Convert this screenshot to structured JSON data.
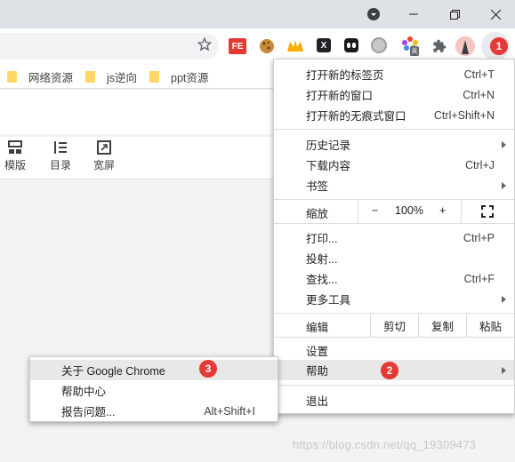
{
  "bookmarks": [
    "网络资源",
    "js逆向",
    "ppt资源"
  ],
  "page_tools": [
    {
      "label": "模版",
      "icon": "template-icon"
    },
    {
      "label": "目录",
      "icon": "list-icon"
    },
    {
      "label": "宽屏",
      "icon": "widescreen-icon"
    }
  ],
  "extensions": {
    "fe_label": "FE",
    "x_label": "X",
    "flower_badge": "关"
  },
  "menu": {
    "new_tab": {
      "label": "打开新的标签页",
      "shortcut": "Ctrl+T"
    },
    "new_window": {
      "label": "打开新的窗口",
      "shortcut": "Ctrl+N"
    },
    "new_incognito": {
      "label": "打开新的无痕式窗口",
      "shortcut": "Ctrl+Shift+N"
    },
    "history": {
      "label": "历史记录"
    },
    "downloads": {
      "label": "下载内容",
      "shortcut": "Ctrl+J"
    },
    "bookmarks": {
      "label": "书签"
    },
    "zoom": {
      "label": "缩放",
      "minus": "−",
      "value": "100%",
      "plus": "+"
    },
    "print": {
      "label": "打印...",
      "shortcut": "Ctrl+P"
    },
    "cast": {
      "label": "投射..."
    },
    "find": {
      "label": "查找...",
      "shortcut": "Ctrl+F"
    },
    "more_tools": {
      "label": "更多工具"
    },
    "edit": {
      "label": "编辑",
      "cut": "剪切",
      "copy": "复制",
      "paste": "粘贴"
    },
    "settings": {
      "label": "设置"
    },
    "help": {
      "label": "帮助"
    },
    "exit": {
      "label": "退出"
    }
  },
  "help_submenu": {
    "about": {
      "label": "关于 Google Chrome"
    },
    "help_center": {
      "label": "帮助中心"
    },
    "report": {
      "label": "报告问题...",
      "shortcut": "Alt+Shift+I"
    }
  },
  "badges": {
    "menu_button": "1",
    "help": "2",
    "about": "3"
  },
  "watermark": "https://blog.csdn.net/qq_19309473",
  "colors": {
    "badge": "#e53935",
    "highlight": "#e8e8e8",
    "titlebar": "#dee1e6"
  }
}
